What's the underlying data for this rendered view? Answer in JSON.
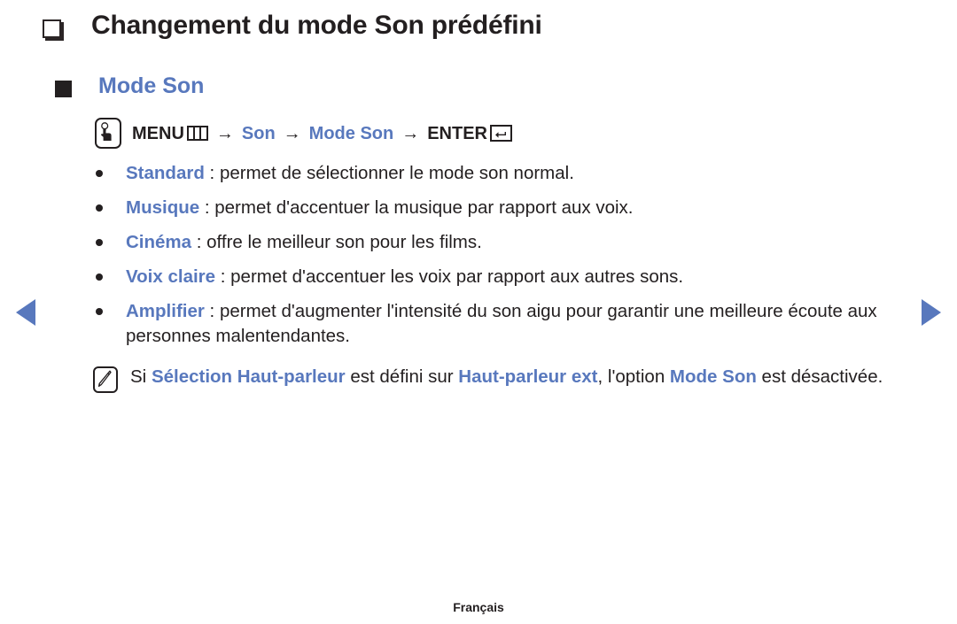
{
  "page": {
    "title": "Changement du mode Son prédéfini",
    "section_heading": "Mode Son",
    "footer_language": "Français"
  },
  "menu_path": {
    "remote_icon": "oo-remote-icon",
    "menu_label": "MENU",
    "menu_icon": "menu-grid-icon",
    "arrow1": "→",
    "step_son": "Son",
    "arrow2": "→",
    "step_mode_son": "Mode Son",
    "arrow3": "→",
    "enter_label": "ENTER",
    "enter_icon": "enter-return-icon"
  },
  "sound_modes": [
    {
      "term": "Standard",
      "separator": " : ",
      "description": "permet de sélectionner le mode son normal."
    },
    {
      "term": "Musique",
      "separator": " : ",
      "description": "permet d'accentuer la musique par rapport aux voix."
    },
    {
      "term": "Cinéma",
      "separator": " : ",
      "description": "offre le meilleur son pour les films."
    },
    {
      "term": "Voix claire",
      "separator": " : ",
      "description": "permet d'accentuer les voix par rapport aux autres sons."
    },
    {
      "term": "Amplifier",
      "separator": " : ",
      "description": "permet d'augmenter l'intensité du son aigu pour garantir une meilleure écoute aux personnes malentendantes."
    }
  ],
  "note": {
    "icon": "note-pencil-icon",
    "part1": "Si ",
    "term1": "Sélection Haut-parleur",
    "part2": " est défini sur ",
    "term2": "Haut-parleur ext",
    "part3": ", l'option ",
    "term3": "Mode Son",
    "part4": " est désactivée."
  },
  "navigation": {
    "prev_label": "prev-page-arrow",
    "next_label": "next-page-arrow"
  },
  "colors": {
    "accent_blue": "#5878bd",
    "text_black": "#231f20",
    "background": "#ffffff"
  }
}
